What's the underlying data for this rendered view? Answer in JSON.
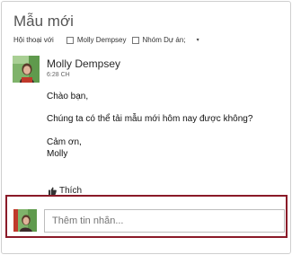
{
  "thread": {
    "title": "Mẫu mới",
    "participants_label": "Hội thoại với",
    "participants": [
      "Molly Dempsey",
      "Nhóm Dự án;"
    ]
  },
  "post": {
    "author": "Molly Dempsey",
    "time": "6:28 CH",
    "lines": [
      "Chào bạn,",
      "Chúng ta có thể tải mẫu mới hôm nay được không?",
      "Cảm ơn,",
      "Molly"
    ],
    "like_label": "Thích"
  },
  "reply": {
    "placeholder": "Thêm tin nhắn..."
  },
  "colors": {
    "highlight_border": "#8a1a28",
    "avatar_accent": "#c0392b"
  }
}
